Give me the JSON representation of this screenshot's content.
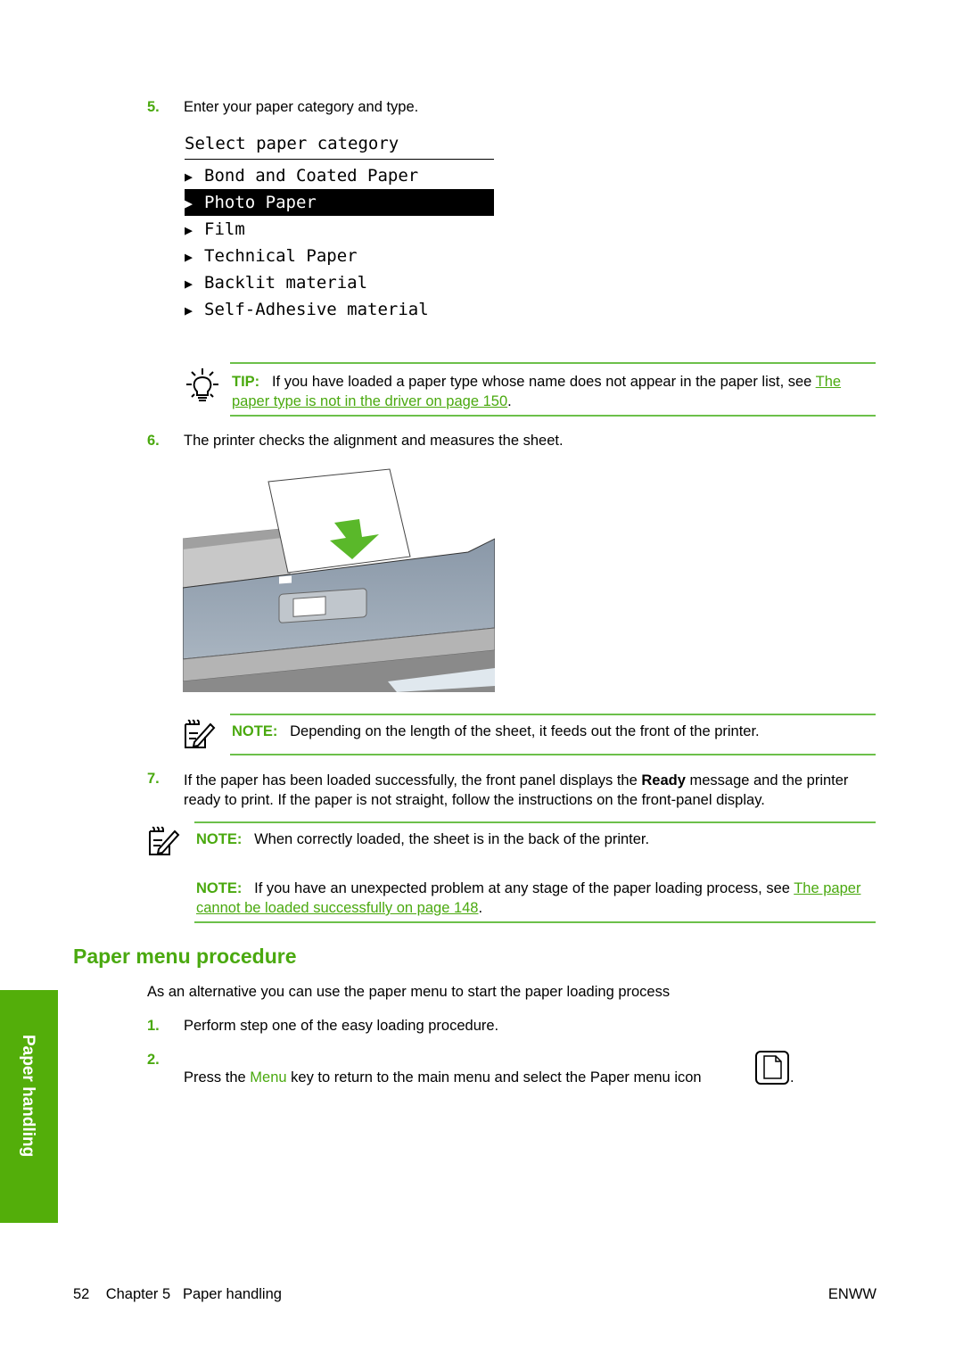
{
  "steps_top": [
    {
      "number": "5.",
      "text": "Enter your paper category and type."
    }
  ],
  "lcd_menu": {
    "title": "Select paper category",
    "items": [
      {
        "label": "Bond and Coated Paper",
        "selected": false
      },
      {
        "label": "Photo Paper",
        "selected": true
      },
      {
        "label": "Film",
        "selected": false
      },
      {
        "label": "Technical Paper",
        "selected": false
      },
      {
        "label": "Backlit material",
        "selected": false
      },
      {
        "label": "Self-Adhesive material",
        "selected": false
      }
    ],
    "arrow_glyph": "▶"
  },
  "tip": {
    "icon": "lightbulb-icon",
    "label": "TIP:",
    "text": "If you have loaded a paper type whose name does not appear in the paper list, see ",
    "link": "The paper type is not in the driver on page 150",
    "end": "."
  },
  "step6": {
    "number": "6.",
    "text": "The printer checks the alignment and measures the sheet."
  },
  "illustration": {
    "alt": "printer-loading-sheet-illustration",
    "arrow_color": "#5ab82a"
  },
  "note1": {
    "icon": "note-pencil-icon",
    "label": "NOTE:",
    "text": "Depending on the length of the sheet, it feeds out the front of the printer."
  },
  "step7": {
    "number": "7.",
    "text_before": "If the paper has been loaded successfully, the front panel displays the ",
    "bold": "Ready",
    "text_after": " message and the printer ready to print. If the paper is not straight, follow the instructions on the front-panel display."
  },
  "note2": {
    "icon": "note-pencil-icon",
    "label": "NOTE:",
    "text": "When correctly loaded, the sheet is in the back of the printer."
  },
  "note3": {
    "label": "NOTE:",
    "text": "If you have an unexpected problem at any stage of the paper loading process, see ",
    "link": "The paper cannot be loaded successfully on page 148",
    "end": "."
  },
  "section": {
    "heading": "Paper menu procedure",
    "intro": "As an alternative you can use the paper menu to start the paper loading process",
    "steps": [
      {
        "number": "1.",
        "text": "Perform step one of the easy loading procedure."
      },
      {
        "number": "2.",
        "text_before": "Press the ",
        "key": "Menu",
        "text_after": " key to return to the main menu and select the Paper menu icon",
        "icon": "paper-menu-icon",
        "end": "."
      }
    ]
  },
  "side_tab": {
    "label": "Paper handling"
  },
  "footer": {
    "page": "52",
    "chapter": "Chapter 5",
    "chapter_title": "Paper handling",
    "right": "ENWW"
  },
  "colors": {
    "accent": "#4aa90f",
    "tab": "#53ae0a",
    "rule": "#6cc04a"
  }
}
